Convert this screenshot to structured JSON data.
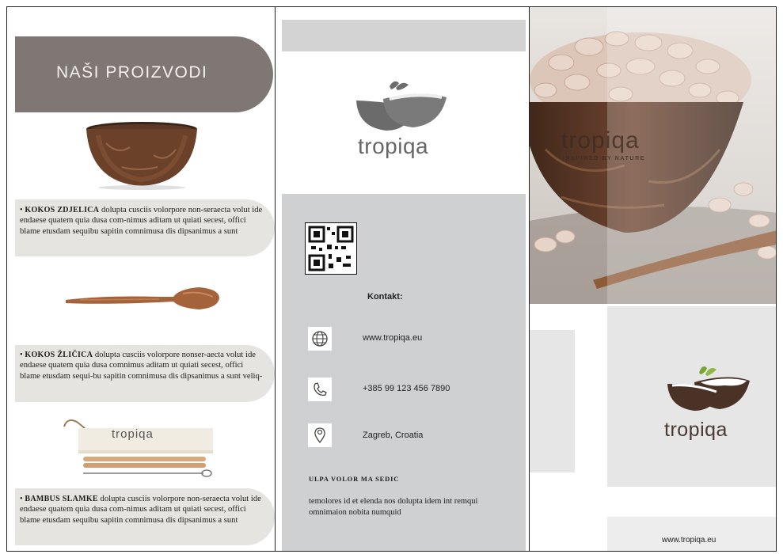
{
  "panel_left": {
    "title": "NAŠI PROIZVODI",
    "products": [
      {
        "name": "KOKOS ZDJELICA",
        "text": "dolupta cusciis volorpore non-seraecta volut ide endaese quatem quia dusa com-nimus aditam ut quiati secest, offici blame etusdam sequibu sapitin comnimusa dis dipsanimus a sunt"
      },
      {
        "name": "KOKOS ŽLIČICA",
        "text": "dolupta cusciis volorpore nonser-aecta volut ide endaese quatem quia dusa comnimus aditam ut quiati secest, offici blame etusdam sequi-bu sapitin comnimusa dis dipsanimus a sunt veliq-"
      },
      {
        "name": "BAMBUS SLAMKE",
        "text": "dolupta cusciis volorpore non-seraecta volut ide endaese quatem quia dusa com-nimus aditam ut quiati secest, offici blame etusdam sequibu sapitin comnimusa dis dipsanimus a sunt"
      }
    ],
    "straw_pack_brand": "tropiqa"
  },
  "panel_middle": {
    "logo_text": "tropiqa",
    "contact_label": "Kontakt:",
    "website": "www.tropiqa.eu",
    "phone": "+385 99 123 456 7890",
    "location": "Zagreb, Croatia",
    "section_heading": "ULPA VOLOR MA SEDIC",
    "section_text": "temolores id et elenda nos dolupta idem int remqui omnimaion nobita numquid"
  },
  "panel_right": {
    "bowl_brand": "tropiqa",
    "bowl_tagline": "INSPIRED BY NATURE",
    "logo_text": "tropiqa",
    "website": "www.tropiqa.eu"
  },
  "colors": {
    "header_band": "#7e7773",
    "light_band": "#e6e4e1",
    "contact_grey": "#cfd0d1",
    "coconut_dark": "#4a3326",
    "leaf_green": "#7aa336"
  },
  "icons": [
    "globe-icon",
    "phone-icon",
    "location-pin-icon",
    "qr-code"
  ]
}
